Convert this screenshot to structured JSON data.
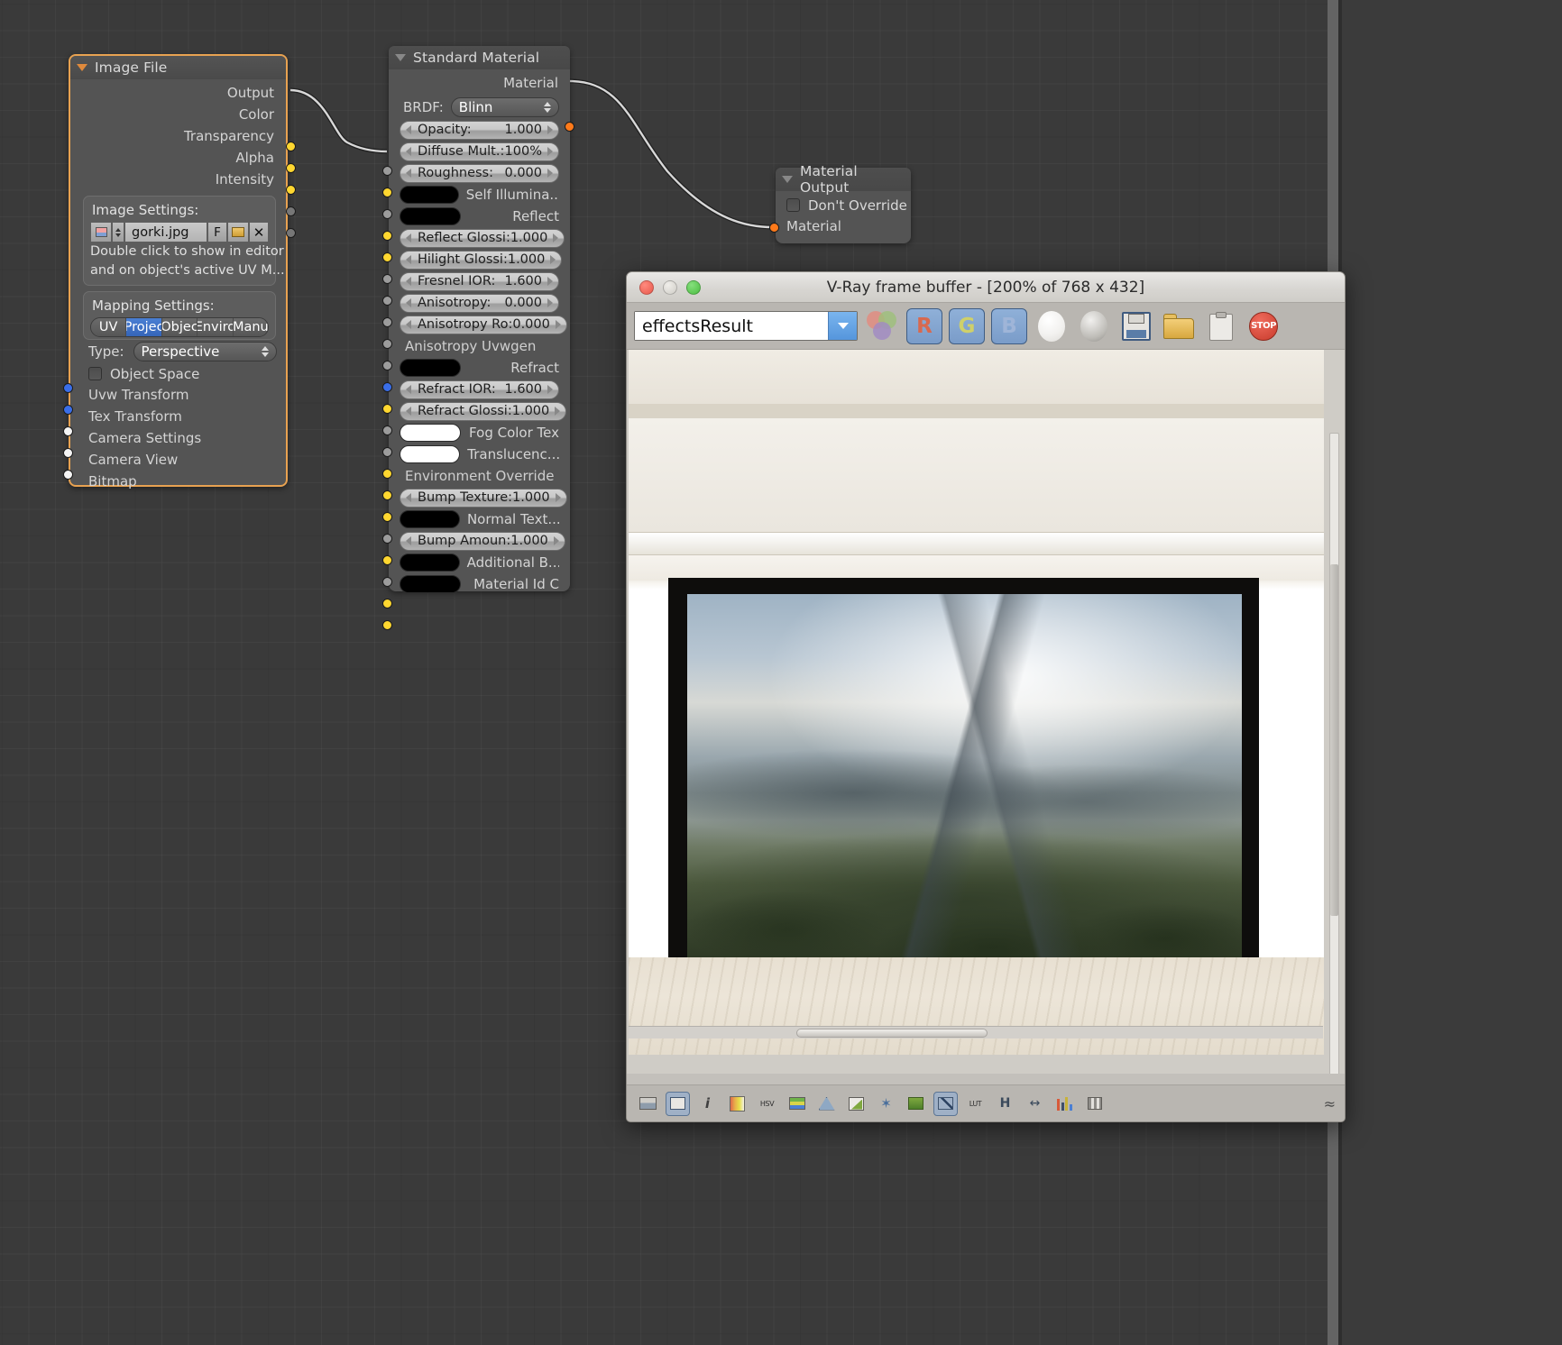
{
  "app": {
    "editor": "node-editor"
  },
  "nodes": {
    "image_file": {
      "title": "Image File",
      "outputs": [
        "Output",
        "Color",
        "Transparency",
        "Alpha",
        "Intensity"
      ],
      "image_settings": {
        "title": "Image Settings:",
        "filename": "gorki.jpg",
        "f_button": "F",
        "hint_line1": "Double click to show in editor",
        "hint_line2": "and on object's active UV M..."
      },
      "mapping_settings": {
        "title": "Mapping Settings:",
        "enum": [
          "UV",
          "Projec",
          "Objec",
          "Enviro",
          "Manu"
        ],
        "enum_selected": "Projec",
        "type_label": "Type:",
        "type_value": "Perspective",
        "object_space_label": "Object Space",
        "object_space_checked": false
      },
      "inputs": [
        "Uvw Transform",
        "Tex Transform",
        "Camera Settings",
        "Camera View",
        "Bitmap"
      ]
    },
    "standard_material": {
      "title": "Standard Material",
      "output": "Material",
      "brdf_label": "BRDF:",
      "brdf_value": "Blinn",
      "rows": [
        {
          "kind": "slider",
          "name": "Opacity:",
          "value": "1.000",
          "socket": "grey"
        },
        {
          "kind": "slider",
          "name": "Diffuse Mult.:",
          "value": "100%",
          "socket": "yellow"
        },
        {
          "kind": "slider",
          "name": "Roughness:",
          "value": "0.000",
          "socket": "grey"
        },
        {
          "kind": "swatch",
          "name": "Self Illumina...",
          "color": "#000000",
          "socket": "yellow"
        },
        {
          "kind": "swatch",
          "name": "Reflect",
          "color": "#000000",
          "socket": "yellow"
        },
        {
          "kind": "slider",
          "name": "Reflect Glossi:",
          "value": "1.000",
          "socket": "grey"
        },
        {
          "kind": "slider",
          "name": "Hilight Glossi:",
          "value": "1.000",
          "socket": "grey"
        },
        {
          "kind": "slider",
          "name": "Fresnel IOR:",
          "value": "1.600",
          "socket": "grey"
        },
        {
          "kind": "slider",
          "name": "Anisotropy:",
          "value": "0.000",
          "socket": "grey"
        },
        {
          "kind": "slider",
          "name": "Anisotropy Ro:",
          "value": "0.000",
          "socket": "grey"
        },
        {
          "kind": "label",
          "name": "Anisotropy Uvwgen",
          "socket": "blue"
        },
        {
          "kind": "swatch",
          "name": "Refract",
          "color": "#000000",
          "socket": "yellow"
        },
        {
          "kind": "slider",
          "name": "Refract IOR:",
          "value": "1.600",
          "socket": "grey"
        },
        {
          "kind": "slider",
          "name": "Refract Glossi:",
          "value": "1.000",
          "socket": "grey"
        },
        {
          "kind": "swatch",
          "name": "Fog Color Tex",
          "color": "#ffffff",
          "socket": "yellow"
        },
        {
          "kind": "swatch",
          "name": "Translucenc...",
          "color": "#ffffff",
          "socket": "yellow"
        },
        {
          "kind": "label",
          "name": "Environment Override",
          "socket": "yellow"
        },
        {
          "kind": "slider",
          "name": "Bump Texture:",
          "value": "1.000",
          "socket": "grey"
        },
        {
          "kind": "swatch",
          "name": "Normal Text...",
          "color": "#000000",
          "socket": "yellow"
        },
        {
          "kind": "slider",
          "name": "Bump Amoun:",
          "value": "1.000",
          "socket": "grey"
        },
        {
          "kind": "swatch",
          "name": "Additional B...",
          "color": "#000000",
          "socket": "yellow"
        },
        {
          "kind": "swatch",
          "name": "Material Id C",
          "color": "#000000",
          "socket": "yellow"
        }
      ]
    },
    "material_output": {
      "title": "Material Output",
      "dont_override_label": "Don't Override",
      "dont_override_checked": false,
      "material_input": "Material"
    }
  },
  "vfb": {
    "title": "V-Ray frame buffer - [200% of 768 x 432]",
    "zoom_percent": "200%",
    "render_width": "768",
    "render_height": "432",
    "window_buttons": {
      "close": "close-button",
      "minimize": "minimize-button",
      "maximize": "maximize-button"
    },
    "channel_combo": {
      "value": "effectsResult",
      "placeholder": "effectsResult"
    },
    "toolbar": [
      {
        "name": "rgb-color-button",
        "label": ""
      },
      {
        "name": "red-channel-button",
        "label": "R"
      },
      {
        "name": "green-channel-button",
        "label": "G"
      },
      {
        "name": "blue-channel-button",
        "label": "B"
      },
      {
        "name": "alpha-white-button",
        "label": ""
      },
      {
        "name": "alpha-grey-button",
        "label": ""
      },
      {
        "name": "save-image-button",
        "label": ""
      },
      {
        "name": "load-image-button",
        "label": ""
      },
      {
        "name": "copy-clipboard-button",
        "label": ""
      },
      {
        "name": "stop-render-button",
        "label": "STOP"
      }
    ],
    "bottom_toolbar": [
      {
        "name": "region-render-button"
      },
      {
        "name": "pixel-aspect-button"
      },
      {
        "name": "info-button"
      },
      {
        "name": "color-corrections-button"
      },
      {
        "name": "hsv-exponential-button"
      },
      {
        "name": "lut-button"
      },
      {
        "name": "curve-button"
      },
      {
        "name": "levels-button"
      },
      {
        "name": "white-balance-button"
      },
      {
        "name": "exposure-button"
      },
      {
        "name": "srgb-button"
      },
      {
        "name": "ocio-button"
      },
      {
        "name": "horizontal-stereo-button"
      },
      {
        "name": "stereo-shift-button"
      },
      {
        "name": "histogram-button"
      },
      {
        "name": "pixel-info-button"
      }
    ],
    "bottom_labels": {
      "info": "i",
      "hsv": "HSV",
      "lut": "LUT"
    }
  }
}
